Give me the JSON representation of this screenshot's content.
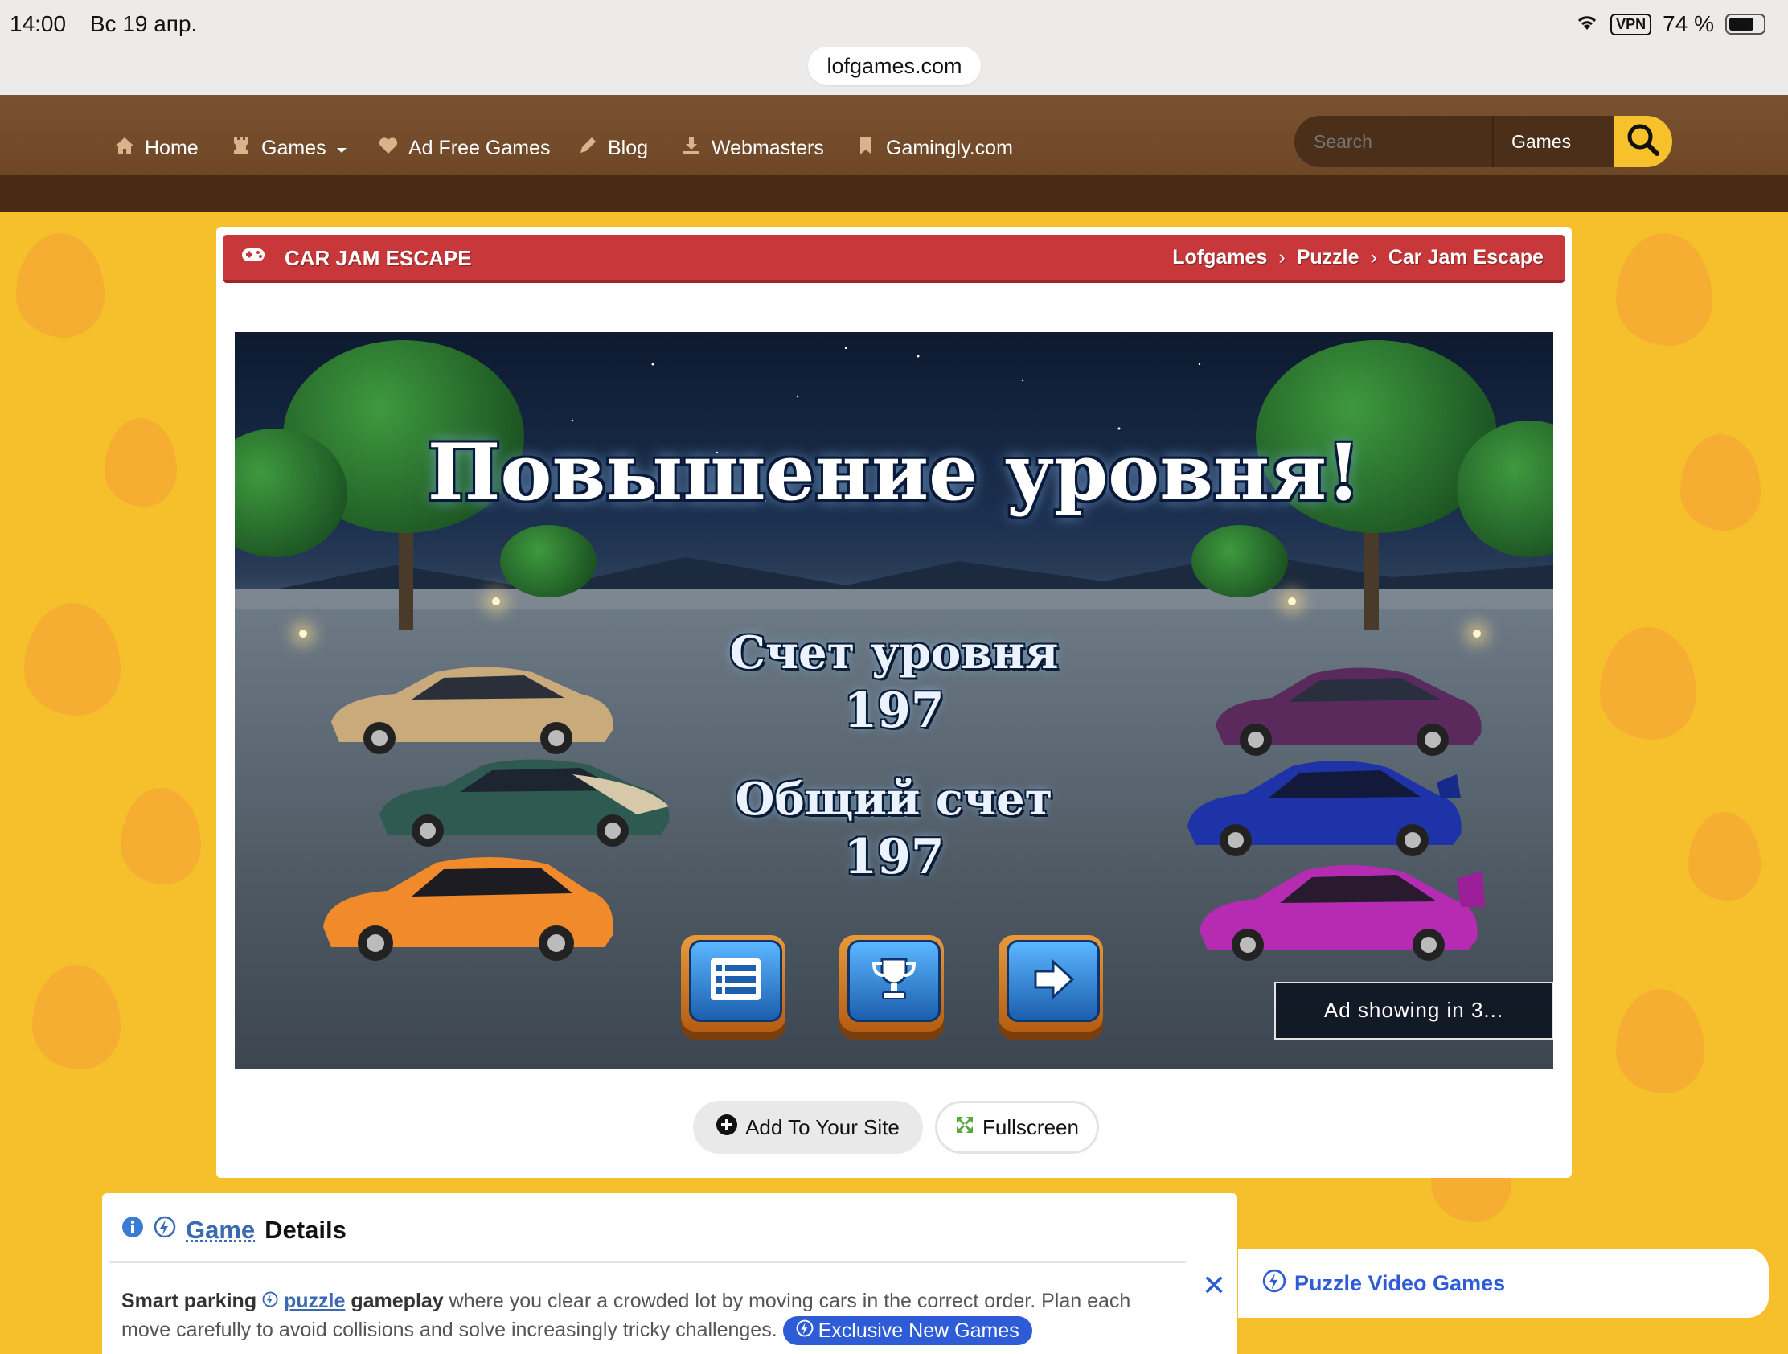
{
  "status": {
    "time": "14:00",
    "date": "Вс 19 апр.",
    "vpn": "VPN",
    "battery": "74 %",
    "battery_level": 0.74
  },
  "url": "lofgames.com",
  "nav": {
    "items": [
      {
        "label": "Home",
        "icon": "home-icon"
      },
      {
        "label": "Games",
        "icon": "chess-rook-icon"
      },
      {
        "label": "Ad Free Games",
        "icon": "heart-icon"
      },
      {
        "label": "Blog",
        "icon": "pencil-icon"
      },
      {
        "label": "Webmasters",
        "icon": "download-icon"
      },
      {
        "label": "Gamingly.com",
        "icon": "bookmark-icon"
      }
    ],
    "search_placeholder": "Search",
    "search_category": "Games"
  },
  "game": {
    "title": "CAR JAM ESCAPE",
    "breadcrumbs": [
      "Lofgames",
      "Puzzle",
      "Car Jam Escape"
    ],
    "screen": {
      "heading": "Повышение уровня!",
      "level_score_label": "Счет уровня",
      "level_score": "197",
      "total_score_label": "Общий счет",
      "total_score": "197",
      "ad_notice": "Ad showing in 3..."
    },
    "buttons": {
      "add": "Add To Your Site",
      "fullscreen": "Fullscreen"
    },
    "colors": {
      "red_bar": "#c8383a",
      "nav": "#6b4221",
      "accent": "#f7c12c"
    }
  },
  "details": {
    "heading_link": "Game",
    "heading_rest": "Details",
    "text_b1": "Smart parking",
    "text_kw": "puzzle",
    "text_b2": "gameplay",
    "text_rest": " where you clear a crowded lot by moving cars in the correct order. Plan each move carefully to avoid collisions and solve increasingly tricky challenges.",
    "exclusive": "Exclusive New Games"
  },
  "promo": {
    "label": "Puzzle Video Games"
  }
}
